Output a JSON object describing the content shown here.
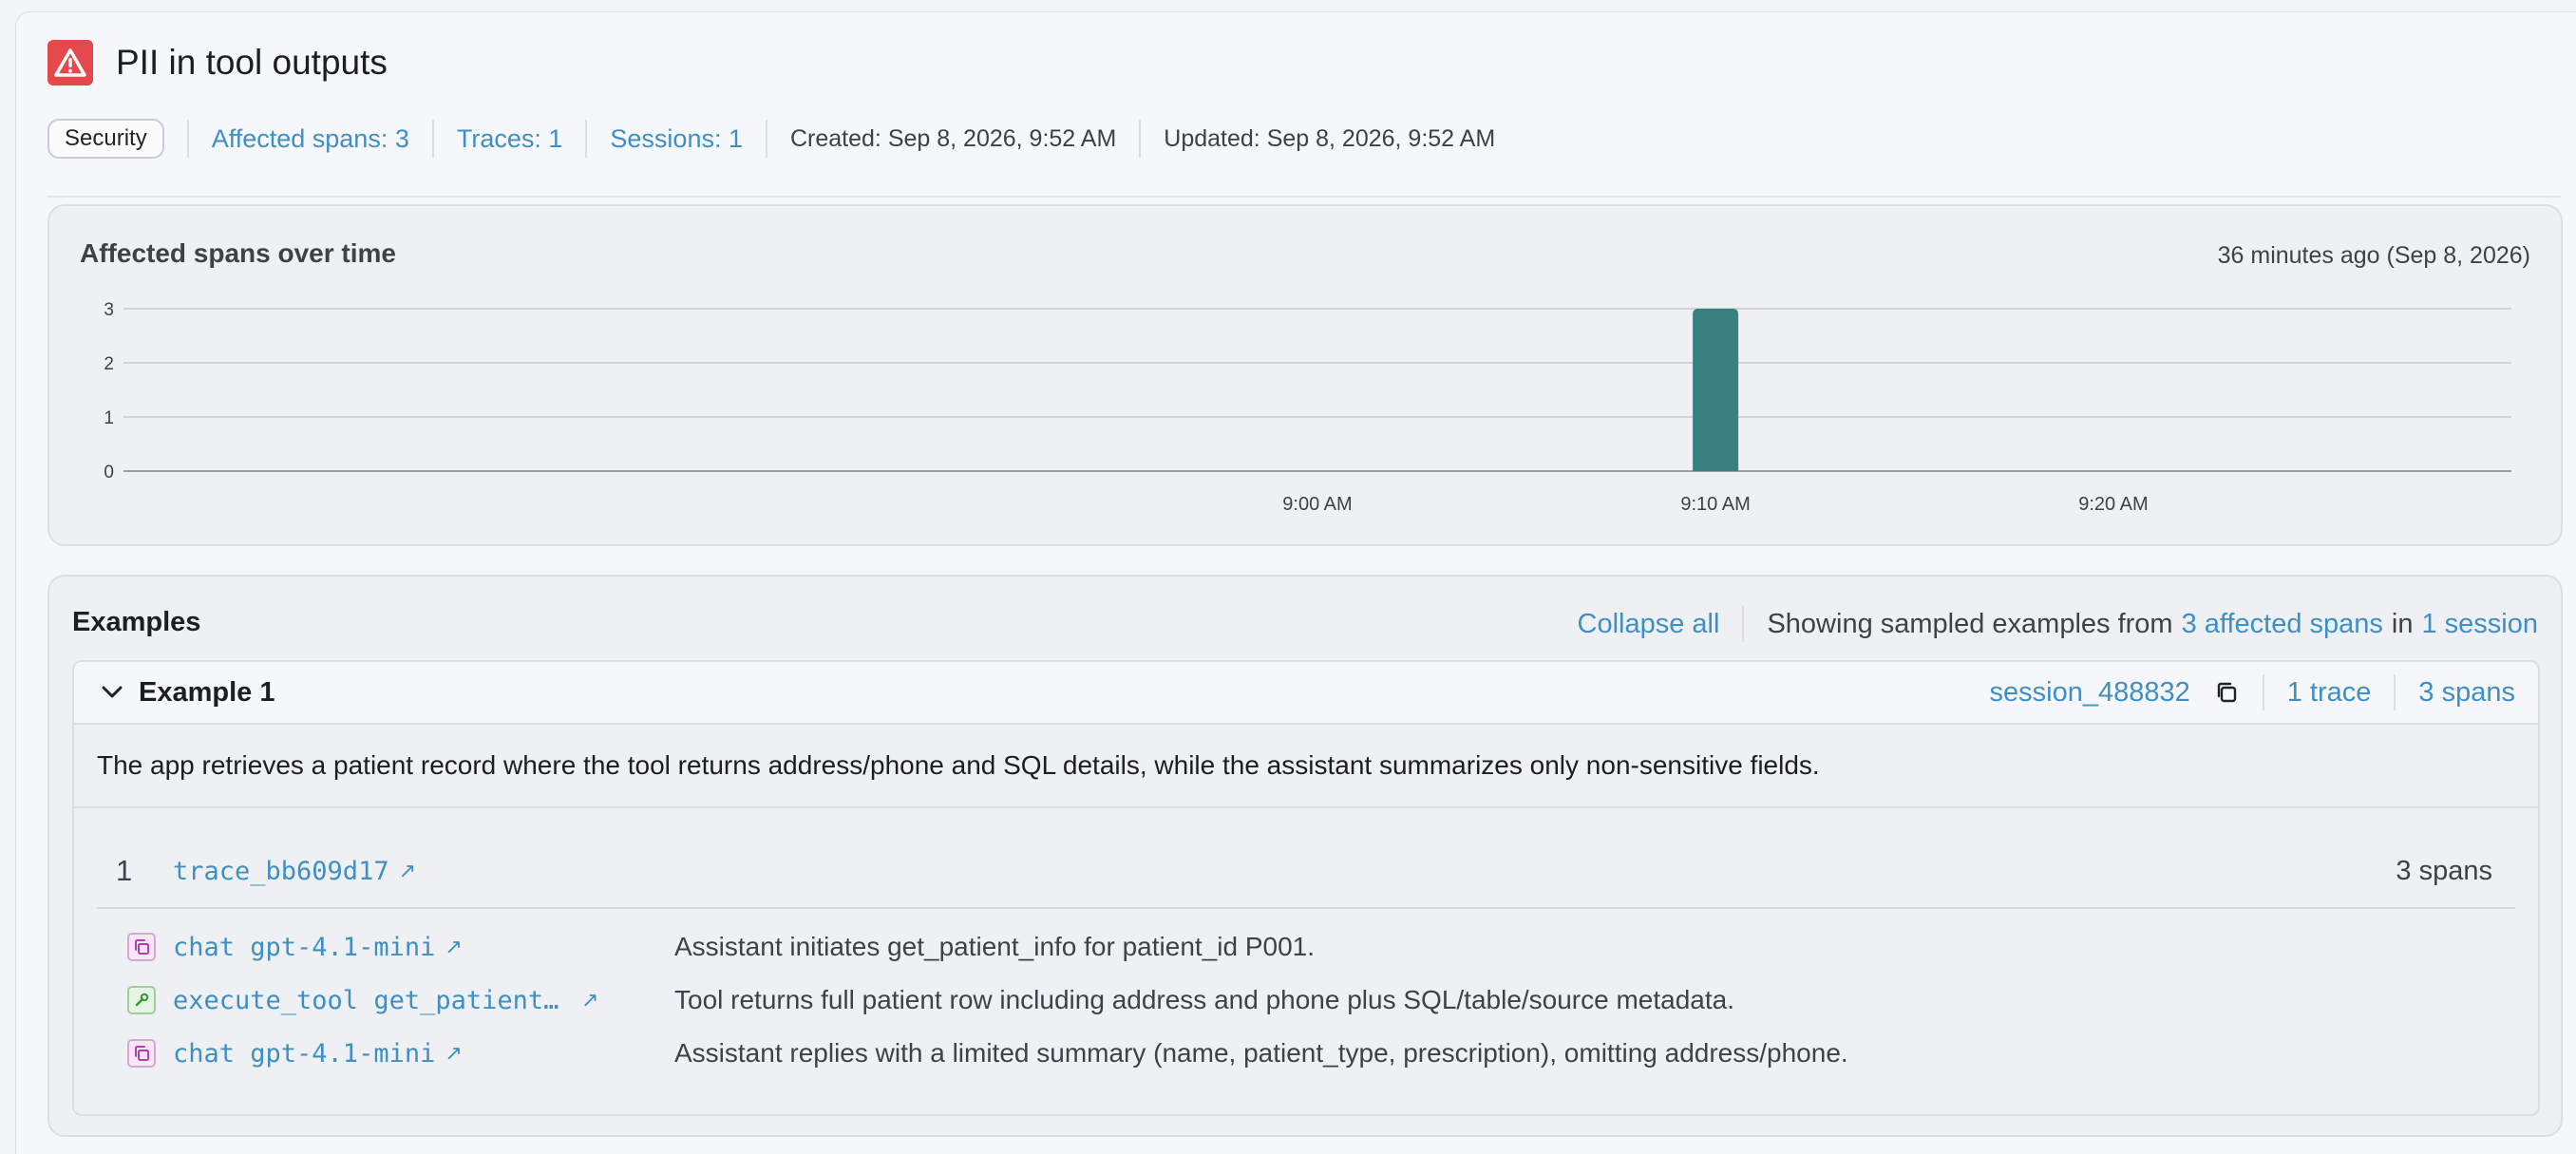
{
  "issue": {
    "title": "PII in tool outputs",
    "category_badge": "Security",
    "affected_spans": "Affected spans: 3",
    "traces": "Traces: 1",
    "sessions": "Sessions: 1",
    "created": "Created: Sep 8, 2026, 9:52 AM",
    "updated": "Updated: Sep 8, 2026, 9:52 AM",
    "colors": {
      "alert": "#e5484d",
      "link": "#3f8fc4",
      "bar": "#3a8080"
    }
  },
  "chart": {
    "title": "Affected spans over time",
    "time_label": "36 minutes ago (Sep 8, 2026)"
  },
  "chart_data": {
    "type": "bar",
    "title": "Affected spans over time",
    "xlabel": "",
    "ylabel": "",
    "ylim": [
      0,
      3
    ],
    "yticks": [
      0,
      1,
      2,
      3
    ],
    "xlim_minutes": [
      8.5,
      9.5
    ],
    "xticks": [
      {
        "label": "9:00 AM",
        "t": 9.0
      },
      {
        "label": "9:10 AM",
        "t": 9.1667
      },
      {
        "label": "9:20 AM",
        "t": 9.3333
      }
    ],
    "points": [
      {
        "t": 9.1667,
        "value": 3
      }
    ],
    "grid": true
  },
  "examples_section": {
    "title": "Examples",
    "collapse_all": "Collapse all",
    "showing_prefix": "Showing sampled examples from",
    "affected_spans_link": "3 affected spans",
    "in_word": "in",
    "session_link": "1 session"
  },
  "example": {
    "name": "Example 1",
    "session_id": "session_488832",
    "trace_count": "1 trace",
    "span_count": "3 spans",
    "description": "The app retrieves a patient record where the tool returns address/phone and SQL details, while the assistant summarizes only non-sensitive fields.",
    "trace": {
      "index": "1",
      "id": "trace_bb609d17",
      "spans": "3 spans"
    },
    "spans": [
      {
        "kind": "chat",
        "name": "chat gpt-4.1-mini",
        "desc": "Assistant initiates get_patient_info for patient_id P001."
      },
      {
        "kind": "tool",
        "name": "execute_tool get_patient_info",
        "desc": "Tool returns full patient row including address and phone plus SQL/table/source metadata."
      },
      {
        "kind": "chat",
        "name": "chat gpt-4.1-mini",
        "desc": "Assistant replies with a limited summary (name, patient_type, prescription), omitting address/phone."
      }
    ]
  }
}
